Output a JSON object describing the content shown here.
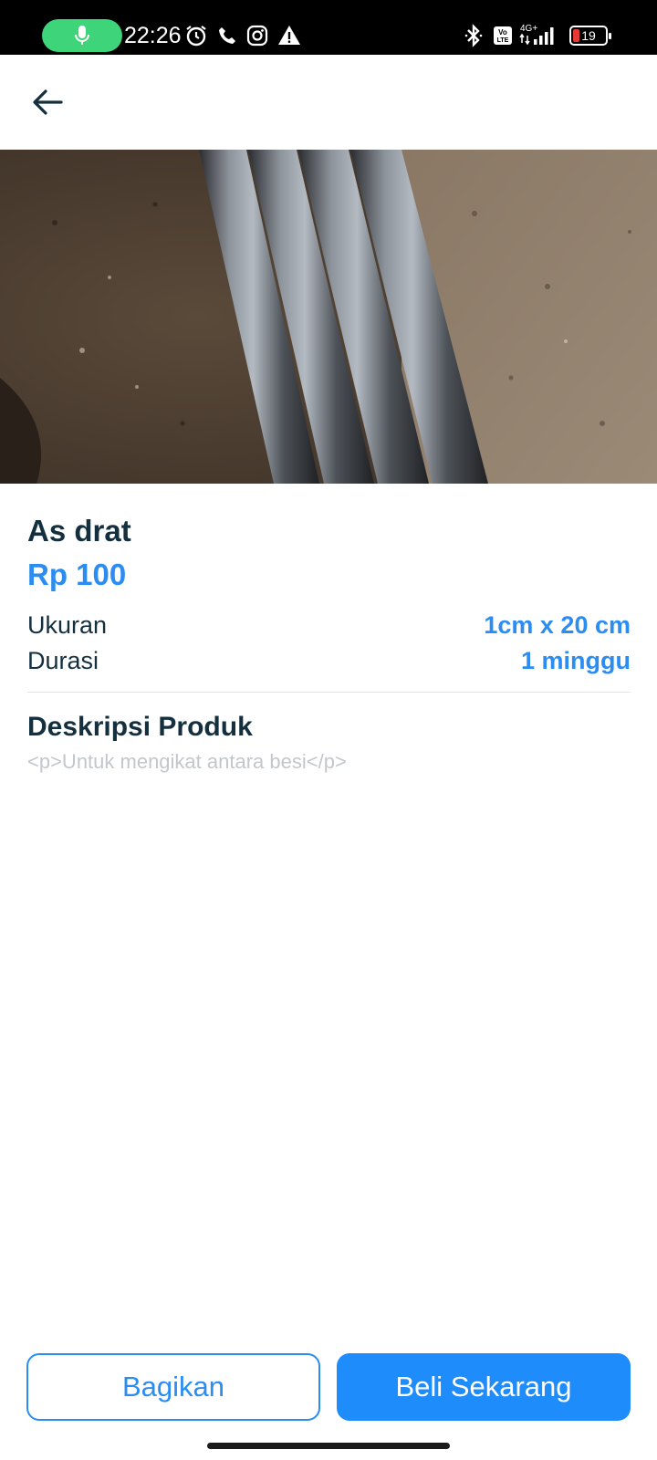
{
  "status_bar": {
    "time": "22:26",
    "battery_level": "19",
    "network_label": "4G+",
    "volte_label": "Vo LTE",
    "icons": [
      "mic-icon",
      "alarm-icon",
      "phone-icon",
      "instagram-icon",
      "warning-icon",
      "bluetooth-icon",
      "volte-icon",
      "signal-icon",
      "battery-icon"
    ]
  },
  "appbar": {
    "back_icon": "arrow-left-icon"
  },
  "product": {
    "name": "As drat",
    "price": "Rp 100",
    "specs": [
      {
        "label": "Ukuran",
        "value": "1cm x 20 cm"
      },
      {
        "label": "Durasi",
        "value": "1 minggu"
      }
    ],
    "description_title": "Deskripsi Produk",
    "description": "<p>Untuk mengikat antara besi</p>"
  },
  "actions": {
    "share_label": "Bagikan",
    "buy_label": "Beli Sekarang"
  },
  "colors": {
    "accent": "#2b8cf2",
    "primary_button": "#1f8cfb",
    "heading": "#14303f",
    "muted_text": "#c2c7cc",
    "mic_pill": "#3dd47a",
    "battery_low": "#e53935"
  }
}
